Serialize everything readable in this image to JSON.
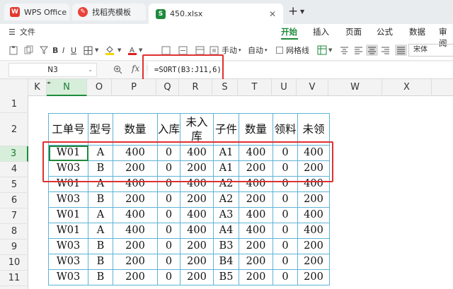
{
  "tabs": [
    {
      "label": "WPS Office",
      "icon": "wps-logo-icon"
    },
    {
      "label": "找稻壳模板",
      "icon": "docer-logo-icon"
    },
    {
      "label": "450.xlsx",
      "icon": "spreadsheet-s-icon"
    }
  ],
  "ribbon": {
    "file_menu": "文件",
    "tabs": [
      "开始",
      "插入",
      "页面",
      "公式",
      "数据",
      "审阅"
    ],
    "active_tab": "开始",
    "accent_color": "#1e8a3c"
  },
  "toolbar": {
    "calc_manual": "手动",
    "calc_auto": "自动",
    "gridlines_label": "网格线",
    "font_name": "宋体"
  },
  "formula_bar": {
    "cell_ref": "N3",
    "fx_label": "fx",
    "formula": "=SORT(B3:J11,6)"
  },
  "sheet": {
    "columns": [
      "K",
      "N",
      "O",
      "P",
      "Q",
      "R",
      "S",
      "T",
      "U",
      "V",
      "W",
      "X"
    ],
    "active_column": "N",
    "rows": [
      "1",
      "2",
      "3",
      "4",
      "5",
      "6",
      "7",
      "8",
      "9",
      "10",
      "11"
    ],
    "active_row": "3",
    "headers": [
      "工单号",
      "型号",
      "数量",
      "入库",
      "未入库",
      "子件",
      "数量",
      "领料",
      "未领"
    ],
    "data": [
      [
        "W01",
        "A",
        "400",
        "0",
        "400",
        "A1",
        "400",
        "0",
        "400"
      ],
      [
        "W03",
        "B",
        "200",
        "0",
        "200",
        "A1",
        "200",
        "0",
        "200"
      ],
      [
        "W01",
        "A",
        "400",
        "0",
        "400",
        "A2",
        "400",
        "0",
        "400"
      ],
      [
        "W03",
        "B",
        "200",
        "0",
        "200",
        "A2",
        "200",
        "0",
        "200"
      ],
      [
        "W01",
        "A",
        "400",
        "0",
        "400",
        "A3",
        "400",
        "0",
        "400"
      ],
      [
        "W01",
        "A",
        "400",
        "0",
        "400",
        "A4",
        "400",
        "0",
        "400"
      ],
      [
        "W03",
        "B",
        "200",
        "0",
        "200",
        "B3",
        "200",
        "0",
        "200"
      ],
      [
        "W03",
        "B",
        "200",
        "0",
        "200",
        "B4",
        "200",
        "0",
        "200"
      ],
      [
        "W03",
        "B",
        "200",
        "0",
        "200",
        "B5",
        "200",
        "0",
        "200"
      ]
    ],
    "highlight_color": "#e03030",
    "table_border_color": "#5fb3d6"
  }
}
